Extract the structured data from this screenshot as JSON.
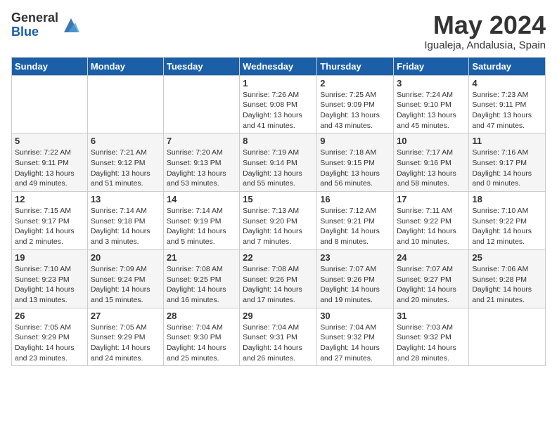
{
  "logo": {
    "general": "General",
    "blue": "Blue"
  },
  "title": "May 2024",
  "location": "Igualeja, Andalusia, Spain",
  "days_of_week": [
    "Sunday",
    "Monday",
    "Tuesday",
    "Wednesday",
    "Thursday",
    "Friday",
    "Saturday"
  ],
  "weeks": [
    [
      {
        "day": "",
        "info": ""
      },
      {
        "day": "",
        "info": ""
      },
      {
        "day": "",
        "info": ""
      },
      {
        "day": "1",
        "info": "Sunrise: 7:26 AM\nSunset: 9:08 PM\nDaylight: 13 hours\nand 41 minutes."
      },
      {
        "day": "2",
        "info": "Sunrise: 7:25 AM\nSunset: 9:09 PM\nDaylight: 13 hours\nand 43 minutes."
      },
      {
        "day": "3",
        "info": "Sunrise: 7:24 AM\nSunset: 9:10 PM\nDaylight: 13 hours\nand 45 minutes."
      },
      {
        "day": "4",
        "info": "Sunrise: 7:23 AM\nSunset: 9:11 PM\nDaylight: 13 hours\nand 47 minutes."
      }
    ],
    [
      {
        "day": "5",
        "info": "Sunrise: 7:22 AM\nSunset: 9:11 PM\nDaylight: 13 hours\nand 49 minutes."
      },
      {
        "day": "6",
        "info": "Sunrise: 7:21 AM\nSunset: 9:12 PM\nDaylight: 13 hours\nand 51 minutes."
      },
      {
        "day": "7",
        "info": "Sunrise: 7:20 AM\nSunset: 9:13 PM\nDaylight: 13 hours\nand 53 minutes."
      },
      {
        "day": "8",
        "info": "Sunrise: 7:19 AM\nSunset: 9:14 PM\nDaylight: 13 hours\nand 55 minutes."
      },
      {
        "day": "9",
        "info": "Sunrise: 7:18 AM\nSunset: 9:15 PM\nDaylight: 13 hours\nand 56 minutes."
      },
      {
        "day": "10",
        "info": "Sunrise: 7:17 AM\nSunset: 9:16 PM\nDaylight: 13 hours\nand 58 minutes."
      },
      {
        "day": "11",
        "info": "Sunrise: 7:16 AM\nSunset: 9:17 PM\nDaylight: 14 hours\nand 0 minutes."
      }
    ],
    [
      {
        "day": "12",
        "info": "Sunrise: 7:15 AM\nSunset: 9:17 PM\nDaylight: 14 hours\nand 2 minutes."
      },
      {
        "day": "13",
        "info": "Sunrise: 7:14 AM\nSunset: 9:18 PM\nDaylight: 14 hours\nand 3 minutes."
      },
      {
        "day": "14",
        "info": "Sunrise: 7:14 AM\nSunset: 9:19 PM\nDaylight: 14 hours\nand 5 minutes."
      },
      {
        "day": "15",
        "info": "Sunrise: 7:13 AM\nSunset: 9:20 PM\nDaylight: 14 hours\nand 7 minutes."
      },
      {
        "day": "16",
        "info": "Sunrise: 7:12 AM\nSunset: 9:21 PM\nDaylight: 14 hours\nand 8 minutes."
      },
      {
        "day": "17",
        "info": "Sunrise: 7:11 AM\nSunset: 9:22 PM\nDaylight: 14 hours\nand 10 minutes."
      },
      {
        "day": "18",
        "info": "Sunrise: 7:10 AM\nSunset: 9:22 PM\nDaylight: 14 hours\nand 12 minutes."
      }
    ],
    [
      {
        "day": "19",
        "info": "Sunrise: 7:10 AM\nSunset: 9:23 PM\nDaylight: 14 hours\nand 13 minutes."
      },
      {
        "day": "20",
        "info": "Sunrise: 7:09 AM\nSunset: 9:24 PM\nDaylight: 14 hours\nand 15 minutes."
      },
      {
        "day": "21",
        "info": "Sunrise: 7:08 AM\nSunset: 9:25 PM\nDaylight: 14 hours\nand 16 minutes."
      },
      {
        "day": "22",
        "info": "Sunrise: 7:08 AM\nSunset: 9:26 PM\nDaylight: 14 hours\nand 17 minutes."
      },
      {
        "day": "23",
        "info": "Sunrise: 7:07 AM\nSunset: 9:26 PM\nDaylight: 14 hours\nand 19 minutes."
      },
      {
        "day": "24",
        "info": "Sunrise: 7:07 AM\nSunset: 9:27 PM\nDaylight: 14 hours\nand 20 minutes."
      },
      {
        "day": "25",
        "info": "Sunrise: 7:06 AM\nSunset: 9:28 PM\nDaylight: 14 hours\nand 21 minutes."
      }
    ],
    [
      {
        "day": "26",
        "info": "Sunrise: 7:05 AM\nSunset: 9:29 PM\nDaylight: 14 hours\nand 23 minutes."
      },
      {
        "day": "27",
        "info": "Sunrise: 7:05 AM\nSunset: 9:29 PM\nDaylight: 14 hours\nand 24 minutes."
      },
      {
        "day": "28",
        "info": "Sunrise: 7:04 AM\nSunset: 9:30 PM\nDaylight: 14 hours\nand 25 minutes."
      },
      {
        "day": "29",
        "info": "Sunrise: 7:04 AM\nSunset: 9:31 PM\nDaylight: 14 hours\nand 26 minutes."
      },
      {
        "day": "30",
        "info": "Sunrise: 7:04 AM\nSunset: 9:32 PM\nDaylight: 14 hours\nand 27 minutes."
      },
      {
        "day": "31",
        "info": "Sunrise: 7:03 AM\nSunset: 9:32 PM\nDaylight: 14 hours\nand 28 minutes."
      },
      {
        "day": "",
        "info": ""
      }
    ]
  ]
}
